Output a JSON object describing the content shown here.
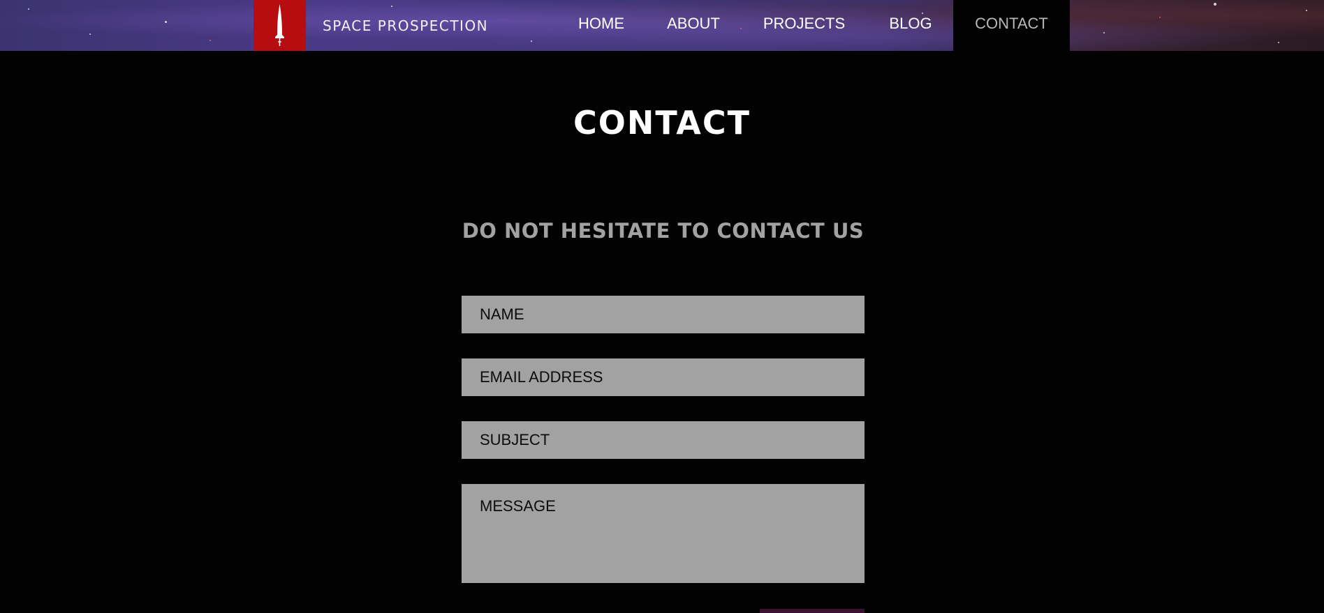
{
  "header": {
    "brand": "SPACE PROSPECTION",
    "logo_icon": "rocket-icon",
    "nav": [
      {
        "label": "HOME",
        "active": false
      },
      {
        "label": "ABOUT",
        "active": false
      },
      {
        "label": "PROJECTS",
        "active": false
      },
      {
        "label": "BLOG",
        "active": false
      },
      {
        "label": "CONTACT",
        "active": true
      }
    ]
  },
  "main": {
    "title": "CONTACT",
    "subtitle": "DO NOT HESITATE TO CONTACT US",
    "form": {
      "name_placeholder": "NAME",
      "email_placeholder": "EMAIL ADDRESS",
      "subject_placeholder": "SUBJECT",
      "message_placeholder": "MESSAGE"
    }
  },
  "colors": {
    "background": "#020202",
    "accent_red": "#b80d10",
    "field_gray": "#a2a2a2",
    "subtitle_gray": "#a2a2a2",
    "nav_active_text": "#b8b8b8"
  }
}
